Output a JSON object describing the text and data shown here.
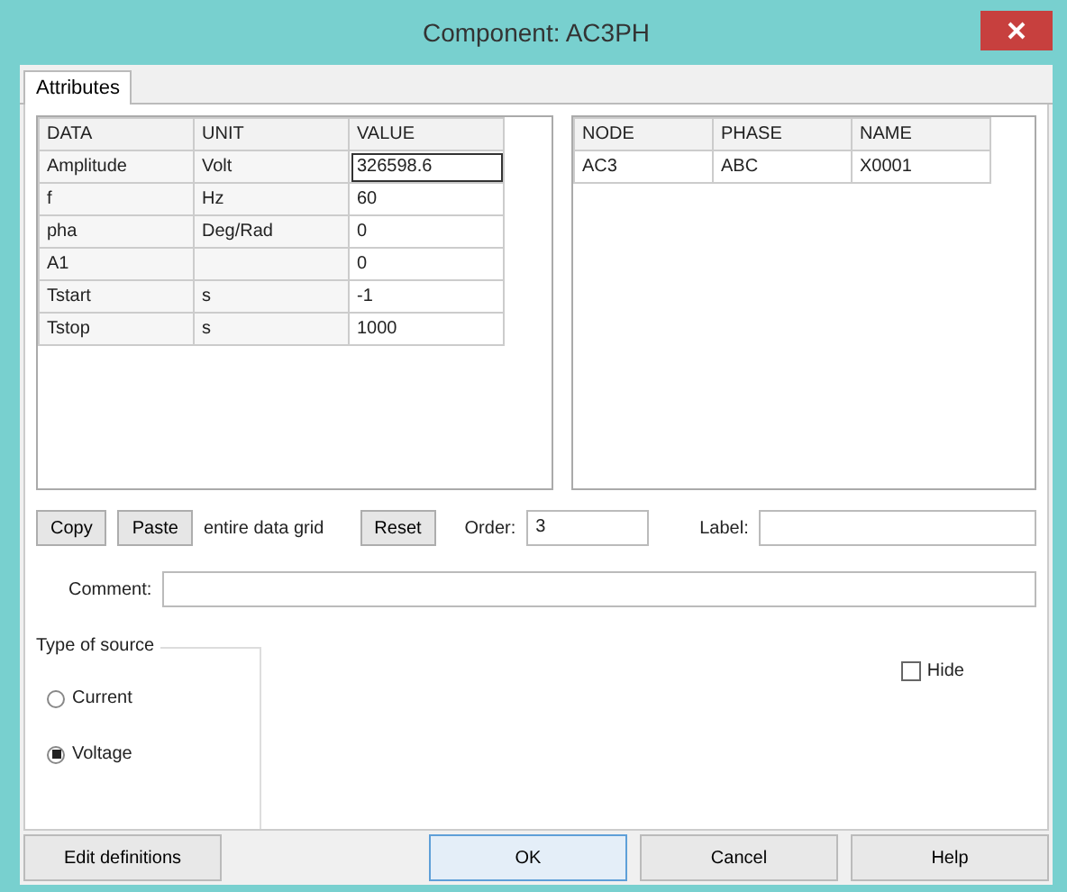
{
  "window": {
    "title": "Component: AC3PH"
  },
  "tabs": [
    {
      "label": "Attributes",
      "selected": true
    }
  ],
  "data_grid": {
    "columns": [
      "DATA",
      "UNIT",
      "VALUE"
    ],
    "rows": [
      {
        "cells": [
          "Amplitude",
          "Volt",
          "326598.6"
        ],
        "editing": true
      },
      {
        "cells": [
          "f",
          "Hz",
          "60"
        ],
        "editing": false
      },
      {
        "cells": [
          "pha",
          "Deg/Rad",
          "0"
        ],
        "editing": false
      },
      {
        "cells": [
          "A1",
          "",
          "0"
        ],
        "editing": false
      },
      {
        "cells": [
          "Tstart",
          "s",
          "-1"
        ],
        "editing": false
      },
      {
        "cells": [
          "Tstop",
          "s",
          "1000"
        ],
        "editing": false
      }
    ]
  },
  "node_grid": {
    "columns": [
      "NODE",
      "PHASE",
      "NAME"
    ],
    "rows": [
      {
        "cells": [
          "AC3",
          "ABC",
          "X0001"
        ]
      }
    ]
  },
  "grid_tools": {
    "copy": "Copy",
    "paste": "Paste",
    "paste_note": "entire data grid",
    "reset": "Reset",
    "order_label": "Order:",
    "order_value": "3",
    "label_label": "Label:"
  },
  "comment": {
    "label": "Comment:"
  },
  "source_type": {
    "title": "Type of source",
    "options": [
      {
        "label": "Current",
        "selected": false
      },
      {
        "label": "Voltage",
        "selected": true
      }
    ]
  },
  "hide": {
    "label": "Hide",
    "checked": false
  },
  "buttons": [
    {
      "label": "Edit definitions",
      "kind": "left"
    },
    {
      "label": "OK",
      "kind": "default"
    },
    {
      "label": "Cancel",
      "kind": "normal"
    },
    {
      "label": "Help",
      "kind": "normal"
    }
  ]
}
